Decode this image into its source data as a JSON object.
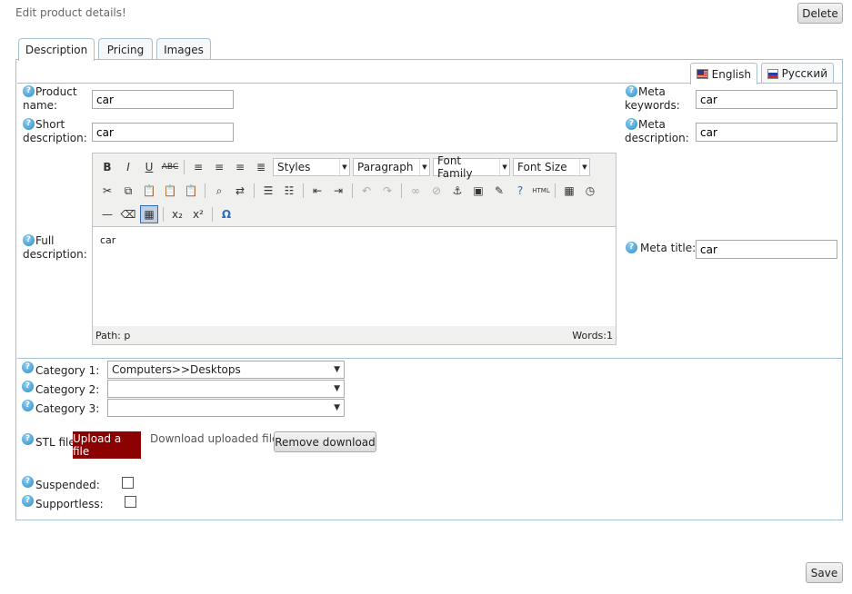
{
  "page": {
    "heading": "Edit product details!",
    "delete_label": "Delete",
    "save_label": "Save"
  },
  "tabs": [
    {
      "label": "Description"
    },
    {
      "label": "Pricing"
    },
    {
      "label": "Images"
    }
  ],
  "languages": [
    {
      "label": "English",
      "flag": "us-flag-icon"
    },
    {
      "label": "Русский",
      "flag": "ru-flag-icon"
    }
  ],
  "fields": {
    "product_name": {
      "label": "Product name:",
      "value": "car"
    },
    "short_description": {
      "label": "Short description:",
      "value": "car"
    },
    "full_description": {
      "label": "Full description:",
      "value": "car"
    },
    "meta_keywords": {
      "label": "Meta keywords:",
      "value": "car"
    },
    "meta_description": {
      "label": "Meta description:",
      "value": "car"
    },
    "meta_title": {
      "label": "Meta title:",
      "value": "car"
    }
  },
  "editor": {
    "styles": "Styles",
    "format": "Paragraph",
    "font_family": "Font Family",
    "font_size": "Font Size",
    "path": "Path: p",
    "words": "Words:1",
    "content": "car"
  },
  "categories": [
    {
      "label": "Category 1:",
      "value": "Computers>>Desktops"
    },
    {
      "label": "Category 2:",
      "value": ""
    },
    {
      "label": "Category 3:",
      "value": ""
    }
  ],
  "stl": {
    "label": "STL file:",
    "upload_label": "Upload a file",
    "download_label": "Download uploaded file",
    "remove_label": "Remove download"
  },
  "flags": {
    "suspended_label": "Suspended:",
    "supportless_label": "Supportless:"
  },
  "colors": {
    "upload_bg": "#8b0000",
    "border": "#a6c0cf",
    "help_icon": "#2b8cc4"
  }
}
